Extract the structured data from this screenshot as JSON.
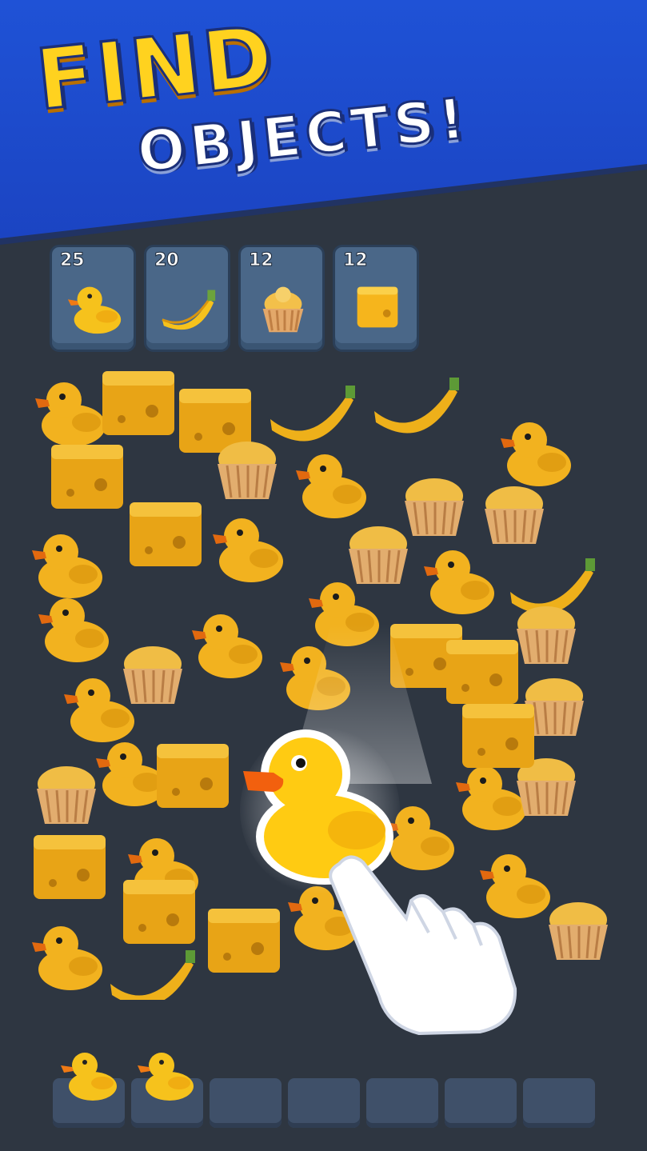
{
  "header": {
    "title_line1": "FIND",
    "title_line2": "OBJECTS!"
  },
  "goals": [
    {
      "count": "25",
      "icon": "duck-icon"
    },
    {
      "count": "20",
      "icon": "banana-icon"
    },
    {
      "count": "12",
      "icon": "cupcake-icon"
    },
    {
      "count": "12",
      "icon": "cheese-icon"
    }
  ],
  "tray": {
    "slots_total": 7,
    "filled": [
      "duck-icon",
      "duck-icon"
    ]
  },
  "colors": {
    "banner": "#1f52d6",
    "title_yellow": "#ffd21f",
    "background": "#2e3641",
    "card": "#4a6788",
    "object_yellow": "#f2b21f"
  }
}
